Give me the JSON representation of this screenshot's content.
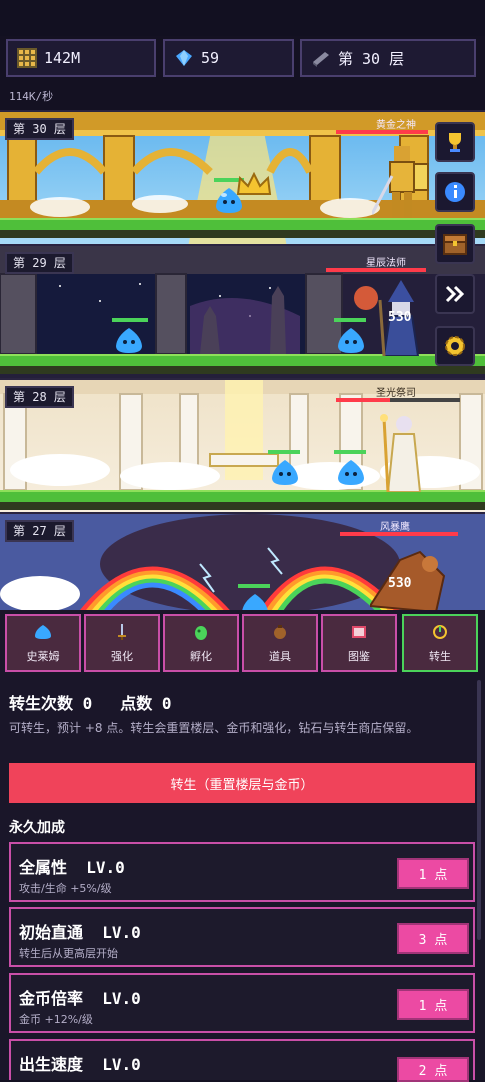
{
  "resources": {
    "gold": "142M",
    "gems": "59",
    "floor": "第 30 层",
    "rate": "114K/秒"
  },
  "floors": [
    {
      "label": "第 30 层",
      "boss_name": "黄金之神"
    },
    {
      "label": "第 29 层",
      "boss_name": "星辰法师",
      "damage": "530"
    },
    {
      "label": "第 28 层",
      "boss_name": "圣光祭司"
    },
    {
      "label": "第 27 层",
      "boss_name": "风暴鹰",
      "damage": "530"
    }
  ],
  "side_buttons": [
    "trophy-icon",
    "info-icon",
    "chest-icon",
    "fast-forward-icon",
    "gear-icon"
  ],
  "tabs": [
    {
      "label": "史莱姆",
      "icon": "slime-icon"
    },
    {
      "label": "强化",
      "icon": "sword-icon"
    },
    {
      "label": "孵化",
      "icon": "egg-icon"
    },
    {
      "label": "道具",
      "icon": "bag-icon"
    },
    {
      "label": "图鉴",
      "icon": "book-icon"
    },
    {
      "label": "转生",
      "icon": "rebirth-icon",
      "active": true
    }
  ],
  "rebirth": {
    "count_label": "转生次数 0",
    "points_label": "点数 0",
    "description": "可转生，预计 +8 点。转生会重置楼层、金币和强化，钻石与转生商店保留。",
    "button_label": "转生（重置楼层与金币）"
  },
  "permanent": {
    "heading": "永久加成",
    "upgrades": [
      {
        "name": "全属性",
        "level": "LV.0",
        "desc": "攻击/生命 +5%/级",
        "cost": "1 点"
      },
      {
        "name": "初始直通",
        "level": "LV.0",
        "desc": "转生后从更高层开始",
        "cost": "3 点"
      },
      {
        "name": "金币倍率",
        "level": "LV.0",
        "desc": "金币 +12%/级",
        "cost": "1 点"
      },
      {
        "name": "出生速度",
        "level": "LV.0",
        "desc": "",
        "cost": "2 点"
      }
    ]
  },
  "colors": {
    "accent_pink": "#ec4aa3",
    "rebirth_red": "#f0435a",
    "active_tab": "#4bd35a",
    "grass": "#4fbf3a"
  }
}
